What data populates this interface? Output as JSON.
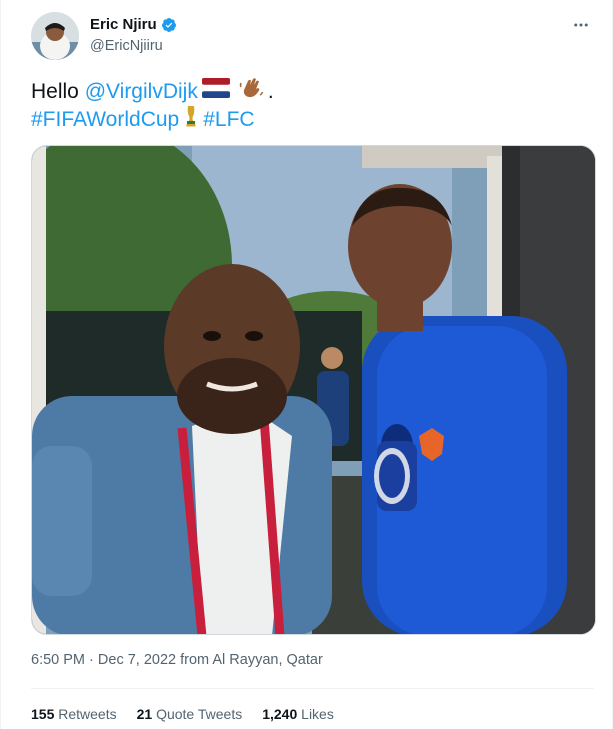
{
  "author": {
    "display_name": "Eric Njiru",
    "handle": "@EricNjiiru",
    "verified_icon": "verified-badge-icon",
    "avatar_icon": "avatar"
  },
  "menu_icon": "more-options-icon",
  "tweet": {
    "hello": "Hello",
    "mention": "@VirgilvDijk",
    "period": ".",
    "hashtag_1": "#FIFAWorldCup",
    "hashtag_2": "#LFC",
    "emojis": [
      "netherlands-flag-icon",
      "waving-hand-icon",
      "trophy-icon"
    ]
  },
  "media": {
    "description_icon": "photo"
  },
  "meta": {
    "time": "6:50 PM",
    "separator": "·",
    "date": "Dec 7, 2022",
    "from": "from",
    "location": "Al Rayyan, Qatar"
  },
  "stats": {
    "retweets_count": "155",
    "retweets_label": "Retweets",
    "quotes_count": "21",
    "quotes_label": "Quote Tweets",
    "likes_count": "1,240",
    "likes_label": "Likes"
  },
  "colors": {
    "accent": "#1d9bf0",
    "secondary_text": "#536471",
    "primary_text": "#0f1419"
  }
}
